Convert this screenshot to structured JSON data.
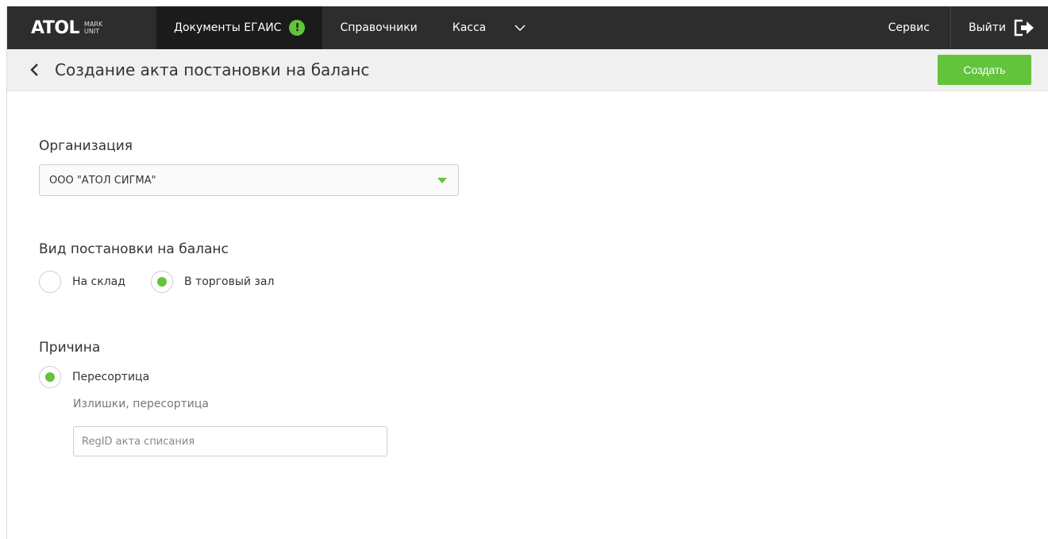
{
  "brand": {
    "name": "ATOL",
    "sub_top": "MARK",
    "sub_bottom": "UNIT"
  },
  "nav": {
    "items": [
      {
        "label": "Документы ЕГАИС",
        "badge": "!"
      },
      {
        "label": "Справочники"
      },
      {
        "label": "Касса"
      }
    ],
    "service": "Сервис",
    "logout": "Выйти"
  },
  "header": {
    "title": "Создание акта постановки на баланс",
    "create_label": "Создать"
  },
  "form": {
    "org_label": "Организация",
    "org_value": "ООО \"АТОЛ СИГМА\"",
    "type_label": "Вид постановки на баланс",
    "type_options": [
      "На склад",
      "В торговый зал"
    ],
    "type_selected": "В торговый зал",
    "reason_label": "Причина",
    "reason_option": "Пересортица",
    "reason_hint": "Излишки, пересортица",
    "regid_placeholder": "RegID акта списания"
  },
  "colors": {
    "accent": "#63c33b",
    "nav_bg": "#2d2d2d",
    "nav_active": "#1b1b1b"
  }
}
